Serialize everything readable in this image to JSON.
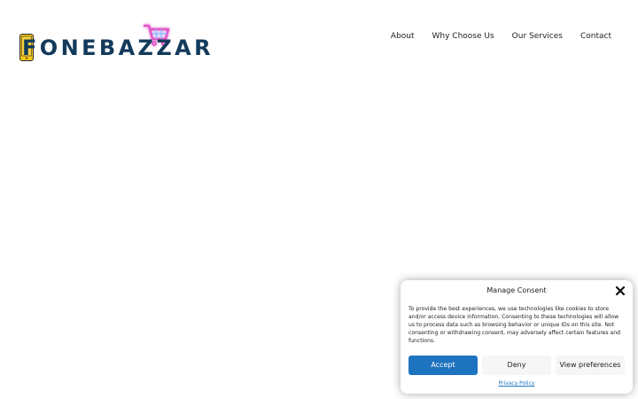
{
  "header": {
    "logo_text": "FONEBAZZAR",
    "nav": [
      {
        "label": "About"
      },
      {
        "label": "Why Choose Us"
      },
      {
        "label": "Our Services"
      },
      {
        "label": "Contact"
      }
    ]
  },
  "consent": {
    "title": "Manage Consent",
    "body": "To provide the best experiences, we use technologies like cookies to store and/or access device information. Consenting to these technologies will allow us to process data such as browsing behavior or unique IDs on this site. Not consenting or withdrawing consent, may adversely affect certain features and functions.",
    "accept_label": "Accept",
    "deny_label": "Deny",
    "preferences_label": "View preferences",
    "policy_link": "Privacy Policy",
    "close_icon": "close-icon"
  },
  "colors": {
    "brand_navy": "#123a5b",
    "accent_blue": "#1e73be",
    "phone_yellow": "#f5c518",
    "cart_pink": "#e254c9"
  }
}
